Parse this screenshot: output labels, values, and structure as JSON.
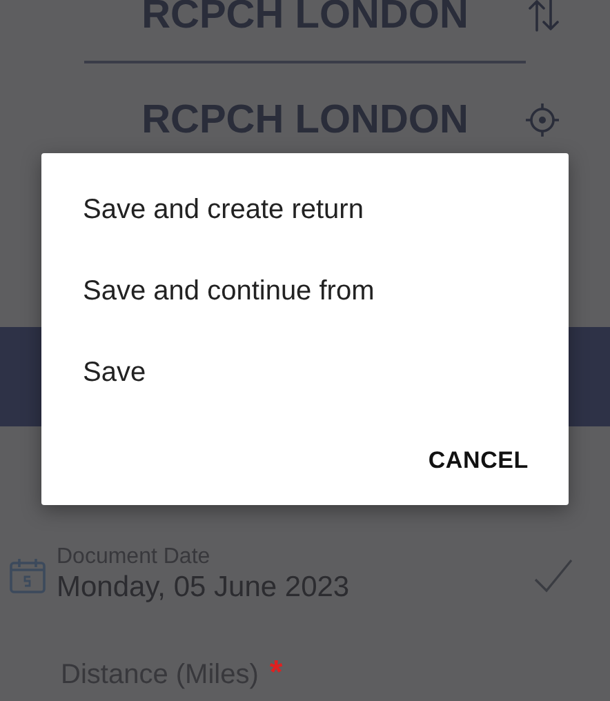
{
  "route": {
    "from": {
      "name": "RCPCH LONDON"
    },
    "to": {
      "name": "RCPCH LONDON"
    }
  },
  "document_date": {
    "label": "Document Date",
    "value": "Monday, 05 June 2023",
    "valid": true
  },
  "distance": {
    "label": "Distance (Miles)",
    "required": true,
    "required_mark": "*"
  },
  "dialog": {
    "options": [
      "Save and create return",
      "Save and continue from",
      "Save"
    ],
    "cancel": "CANCEL"
  }
}
